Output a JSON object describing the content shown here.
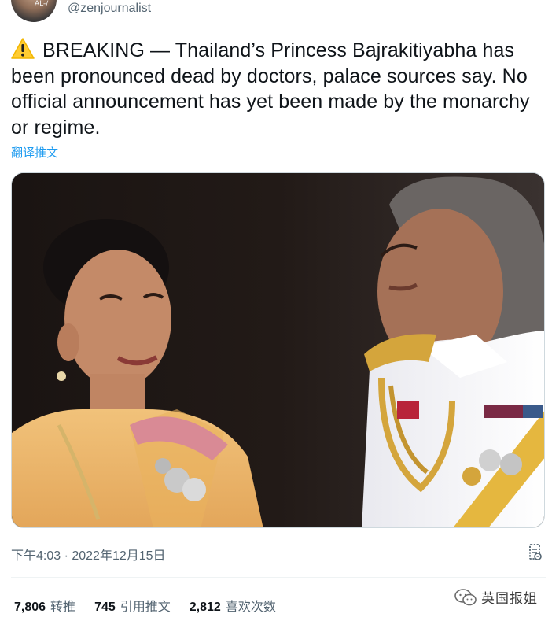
{
  "author": {
    "handle": "@zenjournalist",
    "avatar_tag": "AL-/"
  },
  "tweet": {
    "text": "BREAKING — Thailand’s Princess Bajrakitiyabha has been pronounced dead by doctors, palace sources say. No official announcement has yet been made by the monarchy or regime.",
    "emoji_icon": "warning-icon",
    "translate_link": "翻译推文"
  },
  "meta": {
    "timestamp": "下午4:03 · 2022年12月15日"
  },
  "stats": {
    "retweets_count": "7,806",
    "retweets_label": "转推",
    "quotes_count": "745",
    "quotes_label": "引用推文",
    "likes_count": "2,812",
    "likes_label": "喜欢次数"
  },
  "watermark": {
    "text": "英国报姐",
    "icon": "wechat-logo-icon"
  },
  "colors": {
    "text": "#0f1419",
    "secondary": "#536471",
    "link": "#1d9bf0"
  }
}
